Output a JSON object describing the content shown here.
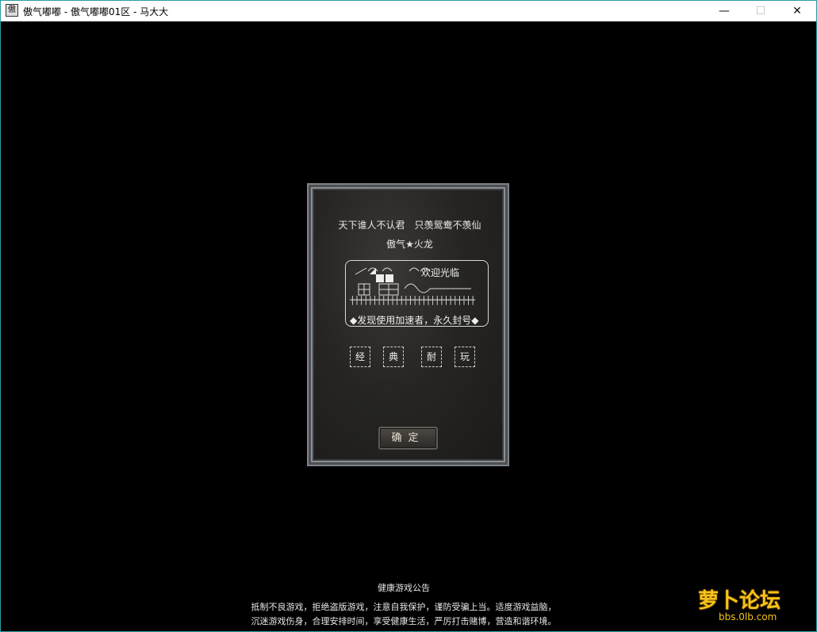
{
  "window": {
    "title": "傲气嘟嘟 - 傲气嘟嘟01区 - 马大大",
    "icon": "app-icon",
    "icon_glyph": "傲",
    "minimize": "—",
    "maximize": "☐",
    "close": "✕"
  },
  "dialog": {
    "line1": "天下谁人不认君　只羡鸳鸯不羡仙",
    "line2": "傲气★火龙",
    "welcome": "欢迎光临",
    "notice": "◆发现使用加速者，永久封号◆",
    "chars": [
      "经",
      "典",
      "耐",
      "玩"
    ],
    "ok_button": "确定"
  },
  "footer": {
    "title": "健康游戏公告",
    "line1": "抵制不良游戏，拒绝盗版游戏，注意自我保护，谨防受骗上当。适度游戏益脑，",
    "line2": "沉迷游戏伤身，合理安排时间，享受健康生活，严厉打击赌博，营造和谐环境。"
  },
  "watermark": {
    "main": "萝卜论坛",
    "url": "bbs.0lb.com"
  }
}
